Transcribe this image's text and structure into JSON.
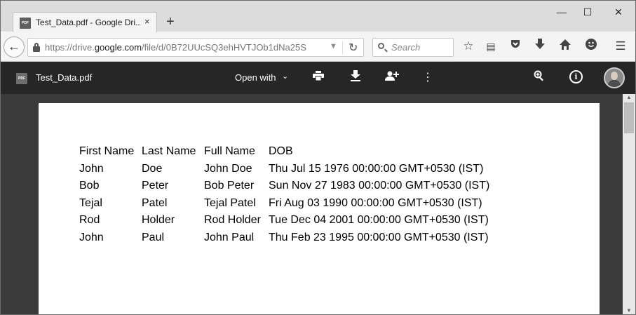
{
  "browser": {
    "tab_title": "Test_Data.pdf - Google Dri...",
    "tab_favicon_text": "PDF",
    "tab_close": "×",
    "new_tab": "+",
    "window_controls": {
      "minimize": "—",
      "maximize": "☐",
      "close": "✕"
    },
    "url_prefix": "https://drive.",
    "url_domain": "google.com",
    "url_path": "/file/d/0B72UUcSQ3ehHVTJOb1dNa25S",
    "search_placeholder": "Search",
    "icons": [
      "back-icon",
      "lock-icon",
      "reload-icon",
      "bookmark-star-icon",
      "reading-list-icon",
      "pocket-icon",
      "download-icon",
      "home-icon",
      "smiley-icon",
      "menu-icon"
    ]
  },
  "drive": {
    "file_icon_text": "PDF",
    "file_name": "Test_Data.pdf",
    "open_with": "Open with",
    "icons": [
      "print-icon",
      "download-icon",
      "add-person-icon",
      "more-vert-icon",
      "zoom-icon",
      "info-icon",
      "avatar"
    ]
  },
  "document": {
    "headers": [
      "First Name",
      "Last Name",
      "Full Name",
      "DOB"
    ],
    "rows": [
      [
        "John",
        "Doe",
        "John Doe",
        "Thu Jul 15 1976 00:00:00 GMT+0530 (IST)"
      ],
      [
        "Bob",
        "Peter",
        "Bob Peter",
        "Sun Nov 27 1983 00:00:00 GMT+0530 (IST)"
      ],
      [
        "Tejal",
        "Patel",
        "Tejal Patel",
        "Fri Aug 03 1990 00:00:00 GMT+0530 (IST)"
      ],
      [
        "Rod",
        "Holder",
        "Rod Holder",
        "Tue Dec 04 2001 00:00:00 GMT+0530 (IST)"
      ],
      [
        "John",
        "Paul",
        "John Paul",
        "Thu Feb 23 1995 00:00:00 GMT+0530 (IST)"
      ]
    ]
  },
  "colors": {
    "drive_toolbar": "#262626",
    "viewer_bg": "#3b3b3b",
    "titlebar": "#dcdcdc"
  }
}
